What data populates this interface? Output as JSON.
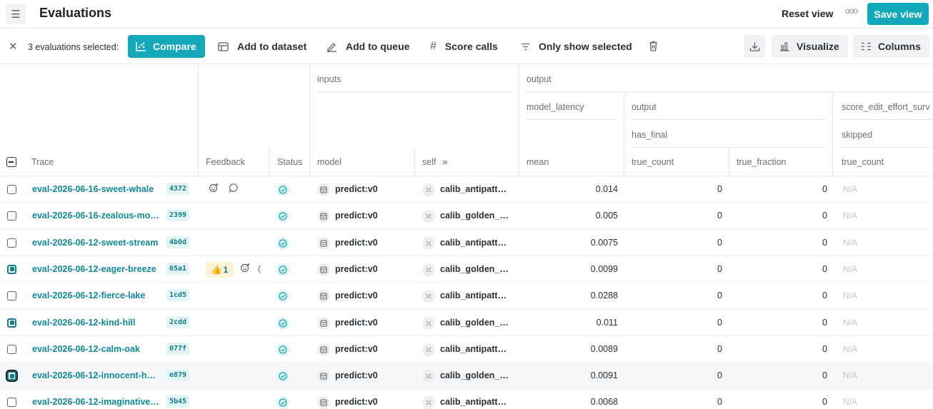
{
  "header": {
    "title": "Evaluations",
    "reset_view": "Reset view",
    "more": "ooo",
    "save_view": "Save view"
  },
  "toolbar": {
    "close": "✕",
    "selected_text": "3 evaluations selected:",
    "compare": "Compare",
    "add_to_dataset": "Add to dataset",
    "add_to_queue": "Add to queue",
    "score_calls": "Score calls",
    "only_show_selected": "Only show selected",
    "visualize": "Visualize",
    "columns": "Columns"
  },
  "table": {
    "group_headers": {
      "inputs": "inputs",
      "output": "output",
      "model_latency": "model_latency",
      "output_sub": "output",
      "score_edit": "score_edit_effort_surv",
      "has_final": "has_final",
      "skipped": "skipped"
    },
    "columns": {
      "trace": "Trace",
      "feedback": "Feedback",
      "status": "Status",
      "model": "model",
      "self": "self",
      "self_expand": "»",
      "mean": "mean",
      "true_count": "true_count",
      "true_fraction": "true_fraction",
      "true_count_2": "true_count"
    },
    "rows": [
      {
        "name": "eval-2026-06-16-sweet-whale",
        "id": "4372",
        "model": "predict:v0",
        "self": "calib_antipatt…",
        "mean": "0.014",
        "true_count": "0",
        "true_fraction": "0",
        "na": "N/A"
      },
      {
        "name": "eval-2026-06-16-zealous-mo…",
        "id": "2399",
        "model": "predict:v0",
        "self": "calib_golden_…",
        "mean": "0.005",
        "true_count": "0",
        "true_fraction": "0",
        "na": "N/A"
      },
      {
        "name": "eval-2026-06-12-sweet-stream",
        "id": "4b0d",
        "model": "predict:v0",
        "self": "calib_antipatt…",
        "mean": "0.0075",
        "true_count": "0",
        "true_fraction": "0",
        "na": "N/A"
      },
      {
        "name": "eval-2026-06-12-eager-breeze",
        "id": "65a1",
        "model": "predict:v0",
        "self": "calib_golden_…",
        "mean": "0.0099",
        "true_count": "0",
        "true_fraction": "0",
        "na": "N/A",
        "thumbs": "1"
      },
      {
        "name": "eval-2026-06-12-fierce-lake",
        "id": "1cd5",
        "model": "predict:v0",
        "self": "calib_antipatt…",
        "mean": "0.0288",
        "true_count": "0",
        "true_fraction": "0",
        "na": "N/A"
      },
      {
        "name": "eval-2026-06-12-kind-hill",
        "id": "2cdd",
        "model": "predict:v0",
        "self": "calib_golden_…",
        "mean": "0.011",
        "true_count": "0",
        "true_fraction": "0",
        "na": "N/A"
      },
      {
        "name": "eval-2026-06-12-calm-oak",
        "id": "077f",
        "model": "predict:v0",
        "self": "calib_antipatt…",
        "mean": "0.0089",
        "true_count": "0",
        "true_fraction": "0",
        "na": "N/A"
      },
      {
        "name": "eval-2026-06-12-innocent-h…",
        "id": "e879",
        "model": "predict:v0",
        "self": "calib_golden_…",
        "mean": "0.0091",
        "true_count": "0",
        "true_fraction": "0",
        "na": "N/A"
      },
      {
        "name": "eval-2026-06-12-imaginative…",
        "id": "5b45",
        "model": "predict:v0",
        "self": "calib_antipatt…",
        "mean": "0.0068",
        "true_count": "0",
        "true_fraction": "0",
        "na": "N/A"
      }
    ]
  },
  "colors": {
    "accent": "#13a9ba",
    "link": "#0f8a99",
    "border": "#e3e5e8"
  }
}
